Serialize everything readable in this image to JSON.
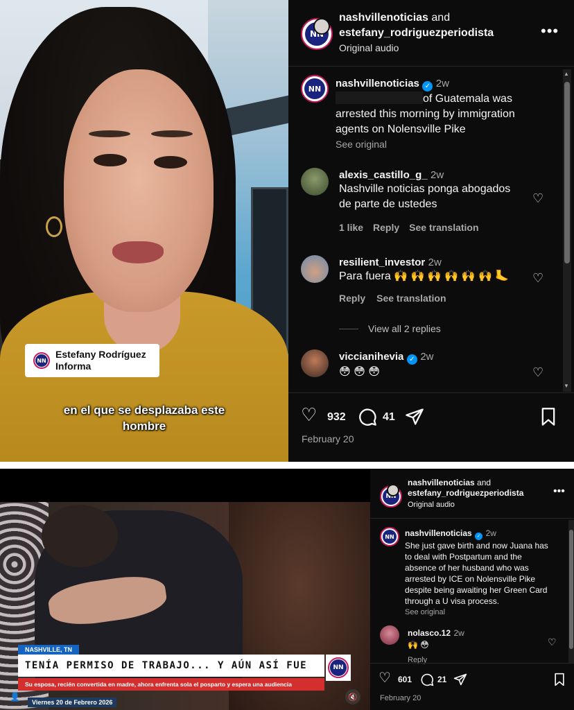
{
  "top": {
    "video": {
      "name_tag": "Estefany Rodríguez\nInforma",
      "caption_line1": "en el que se desplazaba este",
      "caption_line2": "hombre"
    },
    "header": {
      "line1_user": "nashvillenoticias",
      "line1_and": "and",
      "line2_user": "estefany_rodriguezperiodista",
      "audio": "Original audio",
      "more": "•••"
    },
    "caption": {
      "user": "nashvillenoticias",
      "time": "2w",
      "text_line1_after_redaction": "of Guatemala was",
      "text_line2": "arrested this morning by immigration",
      "text_line3": "agents on Nolensville Pike",
      "see_original": "See original"
    },
    "comments": [
      {
        "user": "alexis_castillo_g_",
        "time": "2w",
        "line1": "Nashville noticias ponga abogados",
        "line2": "de parte de ustedes",
        "likes": "1 like",
        "reply": "Reply",
        "translate": "See translation"
      },
      {
        "user": "resilient_investor",
        "time": "2w",
        "line1": "Para fuera 🙌 🙌 🙌 🙌 🙌 🙌  🦶",
        "reply": "Reply",
        "translate": "See translation",
        "view_replies": "View all 2 replies"
      },
      {
        "user": "viccianihevia",
        "time": "2w",
        "line1": "😳 😳 😳"
      }
    ],
    "actions": {
      "likes": "932",
      "comments": "41",
      "date": "February 20"
    }
  },
  "bottom": {
    "video": {
      "location": "NASHVILLE, TN",
      "headline": "TENÍA PERMISO DE TRABAJO... Y AÚN ASÍ FUE DETENIDO",
      "subline": "Su esposa, recién convertida en madre, ahora enfrenta sola el posparto y espera una audiencia",
      "date": "Viernes 20 de Febrero 2026"
    },
    "header": {
      "line1_user": "nashvillenoticias",
      "line1_and": "and",
      "line2_user": "estefany_rodriguezperiodista",
      "audio": "Original audio",
      "more": "•••"
    },
    "caption": {
      "user": "nashvillenoticias",
      "time": "2w",
      "lines": [
        "She just gave birth and now Juana has",
        "to deal with Postpartum and the",
        "absence of her husband who was",
        "arrested by ICE on Nolensville Pike",
        "despite being awaiting her Green Card",
        "through a U visa process."
      ],
      "see_original": "See original"
    },
    "comment": {
      "user": "nolasco.12",
      "time": "2w",
      "text": "🙌 😳",
      "reply": "Reply"
    },
    "actions": {
      "likes": "601",
      "comments": "21",
      "date": "February 20"
    }
  },
  "colors": {
    "background": "#0c0c0d",
    "verified": "#0095f6",
    "muted": "#a8a8a8",
    "brand_ring": "#c2185b"
  },
  "icons": [
    "heart-icon",
    "comment-icon",
    "share-icon",
    "bookmark-icon",
    "verified-icon",
    "more-icon",
    "mute-icon"
  ]
}
